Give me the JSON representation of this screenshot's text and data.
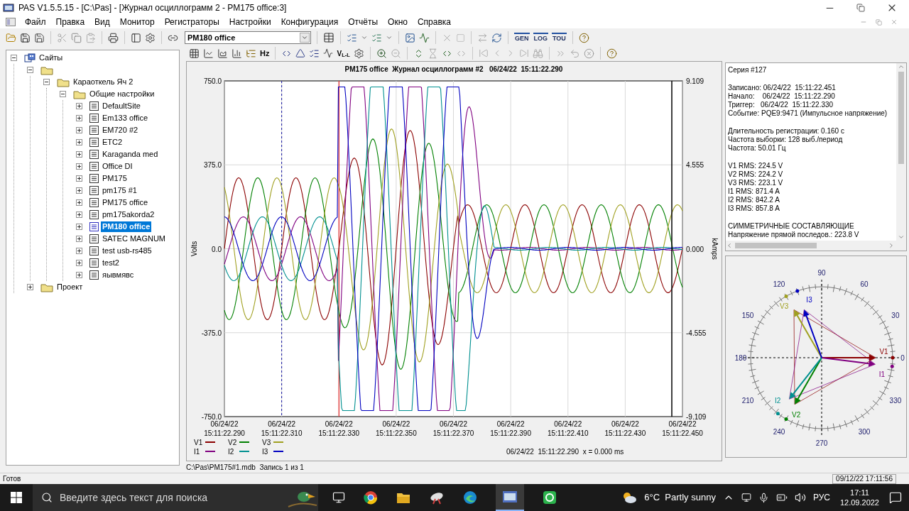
{
  "window": {
    "title": "PAS V1.5.5.15 - [C:\\Pas] - [Журнал осциллограмм 2 - PM175 office:3]"
  },
  "menu": [
    "Файл",
    "Правка",
    "Вид",
    "Монитор",
    "Регистраторы",
    "Настройки",
    "Конфигурация",
    "Отчёты",
    "Окно",
    "Справка"
  ],
  "toolbar": {
    "device_select": "PM180 office",
    "report_buttons": [
      "GEN",
      "LOG",
      "TOU"
    ]
  },
  "chart_toolbar": {
    "hz_label": "Hz",
    "vll_label": "V$_{L-L}$"
  },
  "tree": [
    {
      "label": "Сайты",
      "kind": "root",
      "expanded": true,
      "selected": false,
      "children": [
        {
          "kind": "folder",
          "expanded": true,
          "selected": false,
          "children": [
            {
              "label": "Караоткель Яч 2",
              "kind": "folder",
              "expanded": true,
              "selected": false,
              "children": [
                {
                  "label": "Общие настройки",
                  "kind": "folder",
                  "expanded": true,
                  "selected": false,
                  "children": [
                    {
                      "label": "DefaultSite",
                      "kind": "device",
                      "expanded": false,
                      "selected": false
                    },
                    {
                      "label": "Em133 office",
                      "kind": "device",
                      "expanded": false,
                      "selected": false
                    },
                    {
                      "label": "EM720 #2",
                      "kind": "device",
                      "expanded": false,
                      "selected": false
                    },
                    {
                      "label": "ETC2",
                      "kind": "device",
                      "expanded": false,
                      "selected": false
                    },
                    {
                      "label": "Karaganda med",
                      "kind": "device",
                      "expanded": false,
                      "selected": false
                    },
                    {
                      "label": "Office DI",
                      "kind": "device",
                      "expanded": false,
                      "selected": false
                    },
                    {
                      "label": "PM175",
                      "kind": "device",
                      "expanded": false,
                      "selected": false
                    },
                    {
                      "label": "pm175 #1",
                      "kind": "device",
                      "expanded": false,
                      "selected": false
                    },
                    {
                      "label": "PM175 office",
                      "kind": "device",
                      "expanded": false,
                      "selected": false
                    },
                    {
                      "label": "pm175akorda2",
                      "kind": "device",
                      "expanded": false,
                      "selected": false
                    },
                    {
                      "label": "PM180 office",
                      "kind": "device",
                      "expanded": false,
                      "selected": true
                    },
                    {
                      "label": "SATEC MAGNUM",
                      "kind": "device",
                      "expanded": false,
                      "selected": false
                    },
                    {
                      "label": "test usb-rs485",
                      "kind": "device",
                      "expanded": false,
                      "selected": false
                    },
                    {
                      "label": "test2",
                      "kind": "device",
                      "expanded": false,
                      "selected": false
                    },
                    {
                      "label": "яывмявс",
                      "kind": "device",
                      "expanded": false,
                      "selected": false
                    }
                  ]
                }
              ]
            }
          ]
        },
        {
          "label": "Проект",
          "kind": "folder",
          "expanded": false,
          "selected": false
        }
      ]
    }
  ],
  "oscillogram": {
    "title": "PM175 office  Журнал осциллограмм #2   06/24/22  15:11:22.290",
    "left_axis_label": "Volts",
    "right_axis_label": "kAmps",
    "left_ticks": [
      "750.0",
      "375.0",
      "0.0",
      "-375.0",
      "-750.0"
    ],
    "right_ticks": [
      "9.109",
      "4.555",
      "0.000",
      "-4.555",
      "-9.109"
    ],
    "x_ticks": [
      {
        "date": "06/24/22",
        "time": "15:11:22.290"
      },
      {
        "date": "06/24/22",
        "time": "15:11:22.310"
      },
      {
        "date": "06/24/22",
        "time": "15:11:22.330"
      },
      {
        "date": "06/24/22",
        "time": "15:11:22.350"
      },
      {
        "date": "06/24/22",
        "time": "15:11:22.370"
      },
      {
        "date": "06/24/22",
        "time": "15:11:22.390"
      },
      {
        "date": "06/24/22",
        "time": "15:11:22.410"
      },
      {
        "date": "06/24/22",
        "time": "15:11:22.430"
      },
      {
        "date": "06/24/22",
        "time": "15:11:22.450"
      }
    ],
    "legend_rows": [
      [
        {
          "name": "V1",
          "color": "#8b0000"
        },
        {
          "name": "V2",
          "color": "#008000"
        },
        {
          "name": "V3",
          "color": "#a0a020"
        }
      ],
      [
        {
          "name": "I1",
          "color": "#800080"
        },
        {
          "name": "I2",
          "color": "#009090"
        },
        {
          "name": "I3",
          "color": "#0000c0"
        }
      ]
    ],
    "cursor_readout": "06/24/22  15:11:22.290  x = 0.000 ms"
  },
  "info_groups": [
    [
      "Серия #127"
    ],
    [
      "Записано: 06/24/22  15:11:22.451",
      "Начало:    06/24/22  15:11:22.290",
      "Триггер:   06/24/22  15:11:22.330",
      "Событие: PQE9:9471 (Импульсное напряжение)"
    ],
    [
      "Длительность регистрации: 0.160 с",
      "Частота выборки: 128 выб./период",
      "Частота: 50.01 Гц"
    ],
    [
      "V1 RMS: 224.5 V",
      "V2 RMS: 224.2 V",
      "V3 RMS: 223.1 V",
      "I1 RMS: 871.4 A",
      "I2 RMS: 842.2 A",
      "I3 RMS: 857.8 A"
    ],
    [
      "СИММЕТРИЧНЫЕ СОСТАВЛЯЮЩИЕ",
      "Напряжение прямой последов.: 223.8 V"
    ]
  ],
  "phasor": {
    "angle_labels": [
      "0",
      "30",
      "60",
      "90",
      "120",
      "150",
      "180",
      "210",
      "240",
      "270",
      "300",
      "330"
    ],
    "vectors": [
      {
        "name": "V1",
        "color": "#8b0000"
      },
      {
        "name": "V2",
        "color": "#008000"
      },
      {
        "name": "V3",
        "color": "#a0a020"
      },
      {
        "name": "I1",
        "color": "#800080"
      },
      {
        "name": "I2",
        "color": "#009090"
      },
      {
        "name": "I3",
        "color": "#0000c0"
      }
    ]
  },
  "file_status": "C:\\Pas\\PM175#1.mdb  Запись 1 из 1",
  "status_bar": {
    "text": "Готов",
    "datetime": "09/12/22 17:11:56"
  },
  "taskbar": {
    "search_placeholder": "Введите здесь текст для поиска",
    "weather": "6°C  Partly sunny",
    "language": "РУС",
    "time": "17:11",
    "date": "12.09.2022"
  }
}
